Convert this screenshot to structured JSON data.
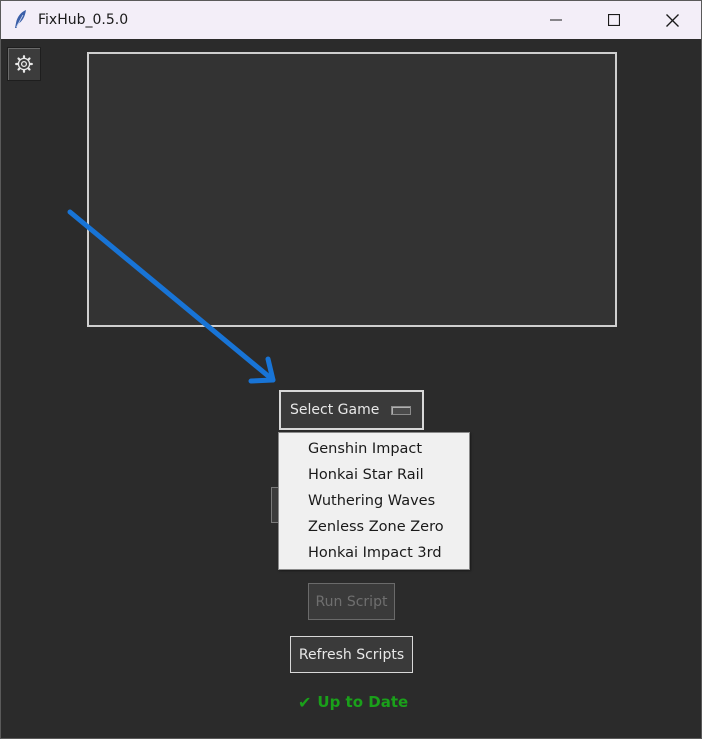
{
  "window": {
    "title": "FixHub_0.5.0",
    "icons": {
      "app": "feather-icon",
      "minimize": "minimize-icon",
      "maximize": "maximize-icon",
      "close": "close-icon"
    }
  },
  "toolbar": {
    "settings_icon": "gear-icon"
  },
  "game_select": {
    "label": "Select Game",
    "options": [
      "Genshin Impact",
      "Honkai Star Rail",
      "Wuthering Waves",
      "Zenless Zone Zero",
      "Honkai Impact 3rd"
    ]
  },
  "actions": {
    "run_label": "Run Script",
    "refresh_label": "Refresh Scripts"
  },
  "status": {
    "icon": "✔",
    "text": "Up to Date",
    "color": "#1aa01a"
  },
  "colors": {
    "annotation_arrow": "#1874d6",
    "background": "#2b2b2b"
  }
}
